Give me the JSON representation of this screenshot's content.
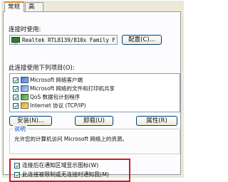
{
  "tabs": [
    {
      "label": "常规",
      "active": true
    },
    {
      "label": "高级",
      "active": false
    }
  ],
  "connection": {
    "connect_using_label": "连接时使用:",
    "adapter_name": "Realtek RTL8139/810x Family F",
    "configure_button": "配置(C)..."
  },
  "items_section": {
    "label": "此连接使用下列项目(O):",
    "items": [
      {
        "label": "Microsoft 网络客户端",
        "checked": true,
        "icon": "network-client-icon"
      },
      {
        "label": "Microsoft 网络的文件和打印机共享",
        "checked": true,
        "icon": "file-printer-sharing-icon"
      },
      {
        "label": "QoS 数据包计划程序",
        "checked": true,
        "icon": "qos-scheduler-icon"
      },
      {
        "label": "Internet 协议 (TCP/IP)",
        "checked": true,
        "icon": "tcp-ip-protocol-icon"
      }
    ]
  },
  "buttons": {
    "install": "安装(N)...",
    "uninstall": "卸载(U)",
    "properties": "属性(R)"
  },
  "description": {
    "title": "说明",
    "text": "允许您的计算机访问 Microsoft 网络上的资源。"
  },
  "options": [
    {
      "label": "连接后在通知区域显示图标(W)",
      "checked": true
    },
    {
      "label": "此连接被限制或无连接时通知我(M)",
      "checked": true
    }
  ],
  "colors": {
    "highlight_border": "#d11a1a",
    "active_tab_accent": "#e68b2c",
    "group_title": "#0046d5"
  }
}
